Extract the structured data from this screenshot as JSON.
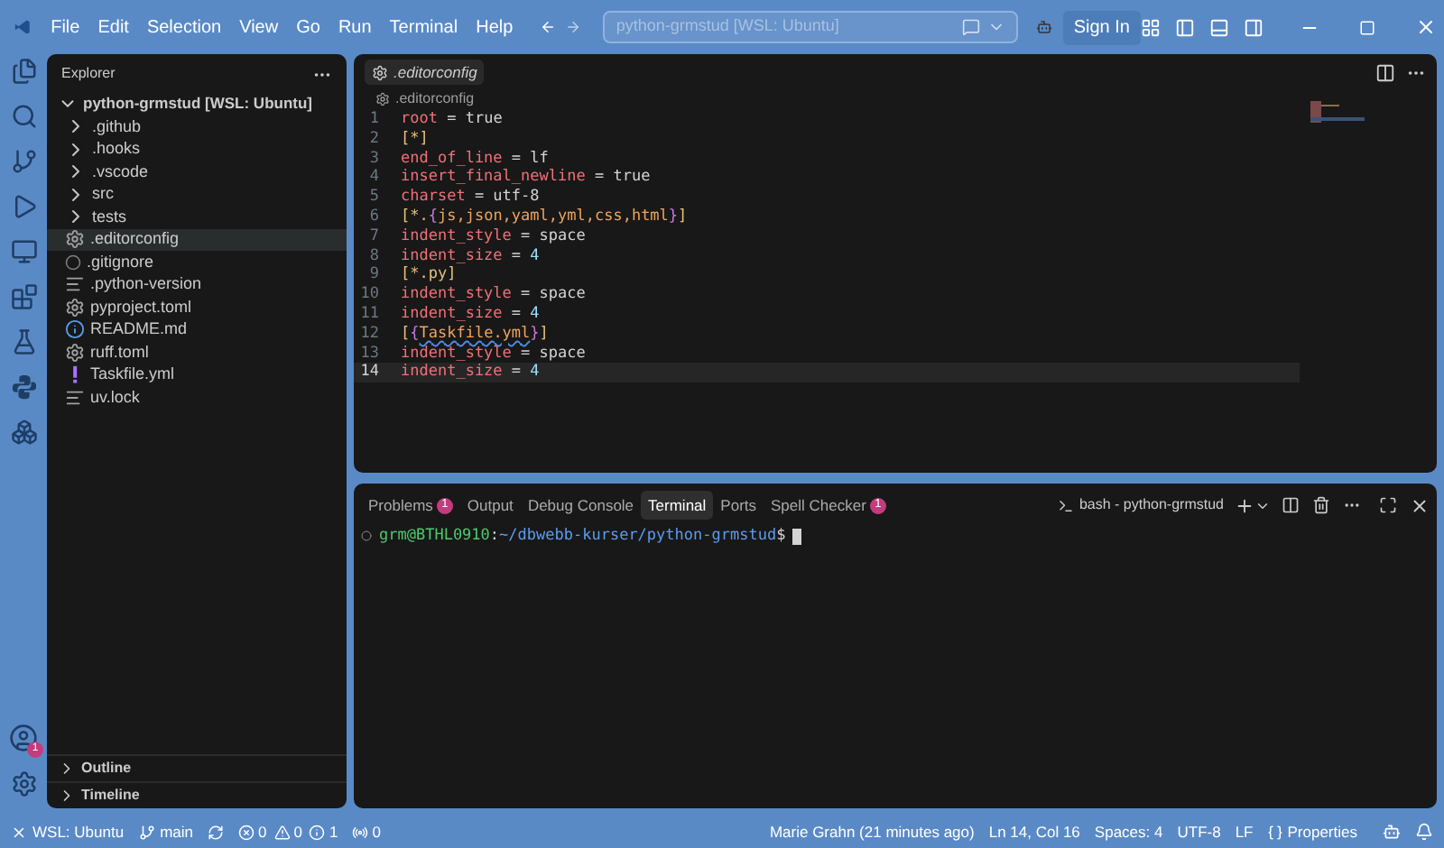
{
  "menu": [
    "File",
    "Edit",
    "Selection",
    "View",
    "Go",
    "Run",
    "Terminal",
    "Help"
  ],
  "command_center": {
    "placeholder": "python-grmstud [WSL: Ubuntu]"
  },
  "sign_in": "Sign In",
  "activity_bar": {
    "accounts_badge": "1"
  },
  "explorer": {
    "title": "Explorer",
    "root": {
      "label": "python-grmstud [WSL: Ubuntu]",
      "expanded": true,
      "children": [
        {
          "label": ".github",
          "kind": "folder",
          "selected": false
        },
        {
          "label": ".hooks",
          "kind": "folder",
          "selected": false
        },
        {
          "label": ".vscode",
          "kind": "folder",
          "selected": false
        },
        {
          "label": "src",
          "kind": "folder",
          "selected": false
        },
        {
          "label": "tests",
          "kind": "folder",
          "selected": false
        },
        {
          "label": ".editorconfig",
          "kind": "gear",
          "selected": true
        },
        {
          "label": ".gitignore",
          "kind": "dot",
          "selected": false
        },
        {
          "label": ".python-version",
          "kind": "lines",
          "selected": false
        },
        {
          "label": "pyproject.toml",
          "kind": "gear",
          "selected": false
        },
        {
          "label": "README.md",
          "kind": "info",
          "selected": false
        },
        {
          "label": "ruff.toml",
          "kind": "gear",
          "selected": false
        },
        {
          "label": "Taskfile.yml",
          "kind": "bang",
          "selected": false
        },
        {
          "label": "uv.lock",
          "kind": "lines",
          "selected": false
        }
      ]
    },
    "sections": [
      {
        "label": "Outline",
        "expanded": false
      },
      {
        "label": "Timeline",
        "expanded": false
      }
    ]
  },
  "editor": {
    "tab_label": ".editorconfig",
    "breadcrumb": ".editorconfig",
    "lines": [
      {
        "number": "1",
        "current": false,
        "tokens": [
          {
            "text": "root",
            "kind": "key"
          },
          {
            "text": " = true",
            "kind": "plain"
          }
        ]
      },
      {
        "number": "2",
        "current": false,
        "tokens": [
          {
            "text": "[*]",
            "kind": "section"
          }
        ]
      },
      {
        "number": "3",
        "current": false,
        "tokens": [
          {
            "text": "end_of_line",
            "kind": "key"
          },
          {
            "text": " = lf",
            "kind": "plain"
          }
        ]
      },
      {
        "number": "4",
        "current": false,
        "tokens": [
          {
            "text": "insert_final_newline",
            "kind": "key"
          },
          {
            "text": " = true",
            "kind": "plain"
          }
        ]
      },
      {
        "number": "5",
        "current": false,
        "tokens": [
          {
            "text": "charset",
            "kind": "key"
          },
          {
            "text": " = utf-8",
            "kind": "plain"
          }
        ]
      },
      {
        "number": "6",
        "current": false,
        "tokens": [
          {
            "text": "[*.",
            "kind": "section"
          },
          {
            "text": "{",
            "kind": "brace"
          },
          {
            "text": "js,json,yaml,yml,css,html",
            "kind": "glob"
          },
          {
            "text": "}",
            "kind": "brace"
          },
          {
            "text": "]",
            "kind": "section"
          }
        ]
      },
      {
        "number": "7",
        "current": false,
        "tokens": [
          {
            "text": "indent_style",
            "kind": "key"
          },
          {
            "text": " = space",
            "kind": "plain"
          }
        ]
      },
      {
        "number": "8",
        "current": false,
        "tokens": [
          {
            "text": "indent_size",
            "kind": "key"
          },
          {
            "text": " = ",
            "kind": "plain"
          },
          {
            "text": "4",
            "kind": "number"
          }
        ]
      },
      {
        "number": "9",
        "current": false,
        "tokens": [
          {
            "text": "[*.py]",
            "kind": "section"
          }
        ]
      },
      {
        "number": "10",
        "current": false,
        "tokens": [
          {
            "text": "indent_style",
            "kind": "key"
          },
          {
            "text": " = space",
            "kind": "plain"
          }
        ]
      },
      {
        "number": "11",
        "current": false,
        "tokens": [
          {
            "text": "indent_size",
            "kind": "key"
          },
          {
            "text": " = ",
            "kind": "plain"
          },
          {
            "text": "4",
            "kind": "number"
          }
        ]
      },
      {
        "number": "12",
        "current": false,
        "tokens": [
          {
            "text": "[",
            "kind": "section"
          },
          {
            "text": "{",
            "kind": "brace"
          },
          {
            "text": "Taskfile.yml",
            "kind": "misspelled"
          },
          {
            "text": "}",
            "kind": "brace"
          },
          {
            "text": "]",
            "kind": "section"
          }
        ]
      },
      {
        "number": "13",
        "current": false,
        "tokens": [
          {
            "text": "indent_style",
            "kind": "key"
          },
          {
            "text": " = space",
            "kind": "plain"
          }
        ]
      },
      {
        "number": "14",
        "current": true,
        "tokens": [
          {
            "text": "indent_size",
            "kind": "key"
          },
          {
            "text": " = ",
            "kind": "plain"
          },
          {
            "text": "4",
            "kind": "number"
          }
        ]
      }
    ]
  },
  "panel": {
    "tabs": [
      {
        "label": "Problems",
        "selected": false,
        "badge": "1"
      },
      {
        "label": "Output",
        "selected": false
      },
      {
        "label": "Debug Console",
        "selected": false
      },
      {
        "label": "Terminal",
        "selected": true
      },
      {
        "label": "Ports",
        "selected": false
      },
      {
        "label": "Spell Checker",
        "selected": false,
        "badge": "1"
      }
    ],
    "terminal_name": "bash - python-grmstud",
    "prompt": [
      {
        "text": "grm@BTHL0910",
        "kind": "user"
      },
      {
        "text": ":",
        "kind": "plain"
      },
      {
        "text": "~/dbwebb-kurser/python-grmstud",
        "kind": "path"
      },
      {
        "text": "$",
        "kind": "plain"
      }
    ]
  },
  "status_bar": {
    "remote": "WSL: Ubuntu",
    "branch": "main",
    "errors": "0",
    "warnings": "0",
    "infos": "1",
    "ports": "0",
    "blame": "Marie Grahn (21 minutes ago)",
    "position": "Ln 14, Col 16",
    "spaces": "Spaces: 4",
    "encoding": "UTF-8",
    "eol": "LF",
    "language": "Properties"
  }
}
